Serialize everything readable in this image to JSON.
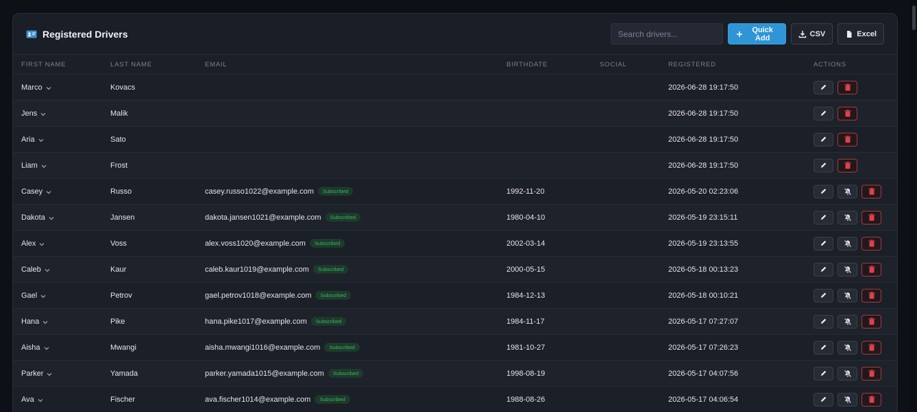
{
  "header": {
    "title": "Registered Drivers",
    "search_placeholder": "Search drivers...",
    "quick_add_label": "Quick Add",
    "csv_label": "CSV",
    "excel_label": "Excel"
  },
  "colors": {
    "accent": "#2f95d6",
    "badge_green": "#3fb36a",
    "danger": "#a83a42"
  },
  "table": {
    "columns": [
      "FIRST NAME",
      "LAST NAME",
      "EMAIL",
      "BIRTHDATE",
      "SOCIAL",
      "REGISTERED",
      "ACTIONS"
    ],
    "rows": [
      {
        "first": "Marco",
        "last": "Kovacs",
        "email": "",
        "subscribed": "",
        "birthdate": "",
        "social": "",
        "registered": "2026-06-28 19:17:50",
        "mute": false
      },
      {
        "first": "Jens",
        "last": "Malik",
        "email": "",
        "subscribed": "",
        "birthdate": "",
        "social": "",
        "registered": "2026-06-28 19:17:50",
        "mute": false
      },
      {
        "first": "Aria",
        "last": "Sato",
        "email": "",
        "subscribed": "",
        "birthdate": "",
        "social": "",
        "registered": "2026-06-28 19:17:50",
        "mute": false
      },
      {
        "first": "Liam",
        "last": "Frost",
        "email": "",
        "subscribed": "",
        "birthdate": "",
        "social": "",
        "registered": "2026-06-28 19:17:50",
        "mute": false
      },
      {
        "first": "Casey",
        "last": "Russo",
        "email": "casey.russo1022@example.com",
        "subscribed": "Subscribed",
        "birthdate": "1992-11-20",
        "social": "",
        "registered": "2026-05-20 02:23:06",
        "mute": true
      },
      {
        "first": "Dakota",
        "last": "Jansen",
        "email": "dakota.jansen1021@example.com",
        "subscribed": "Subscribed",
        "birthdate": "1980-04-10",
        "social": "",
        "registered": "2026-05-19 23:15:11",
        "mute": true
      },
      {
        "first": "Alex",
        "last": "Voss",
        "email": "alex.voss1020@example.com",
        "subscribed": "Subscribed",
        "birthdate": "2002-03-14",
        "social": "",
        "registered": "2026-05-19 23:13:55",
        "mute": true
      },
      {
        "first": "Caleb",
        "last": "Kaur",
        "email": "caleb.kaur1019@example.com",
        "subscribed": "Subscribed",
        "birthdate": "2000-05-15",
        "social": "",
        "registered": "2026-05-18 00:13:23",
        "mute": true
      },
      {
        "first": "Gael",
        "last": "Petrov",
        "email": "gael.petrov1018@example.com",
        "subscribed": "Subscribed",
        "birthdate": "1984-12-13",
        "social": "",
        "registered": "2026-05-18 00:10:21",
        "mute": true
      },
      {
        "first": "Hana",
        "last": "Pike",
        "email": "hana.pike1017@example.com",
        "subscribed": "Subscribed",
        "birthdate": "1984-11-17",
        "social": "",
        "registered": "2026-05-17 07:27:07",
        "mute": true
      },
      {
        "first": "Aisha",
        "last": "Mwangi",
        "email": "aisha.mwangi1016@example.com",
        "subscribed": "Subscribed",
        "birthdate": "1981-10-27",
        "social": "",
        "registered": "2026-05-17 07:26:23",
        "mute": true
      },
      {
        "first": "Parker",
        "last": "Yamada",
        "email": "parker.yamada1015@example.com",
        "subscribed": "Subscribed",
        "birthdate": "1998-08-19",
        "social": "",
        "registered": "2026-05-17 04:07:56",
        "mute": true
      },
      {
        "first": "Ava",
        "last": "Fischer",
        "email": "ava.fischer1014@example.com",
        "subscribed": "Subscribed",
        "birthdate": "1988-08-26",
        "social": "",
        "registered": "2026-05-17 04:06:54",
        "mute": true
      }
    ]
  }
}
